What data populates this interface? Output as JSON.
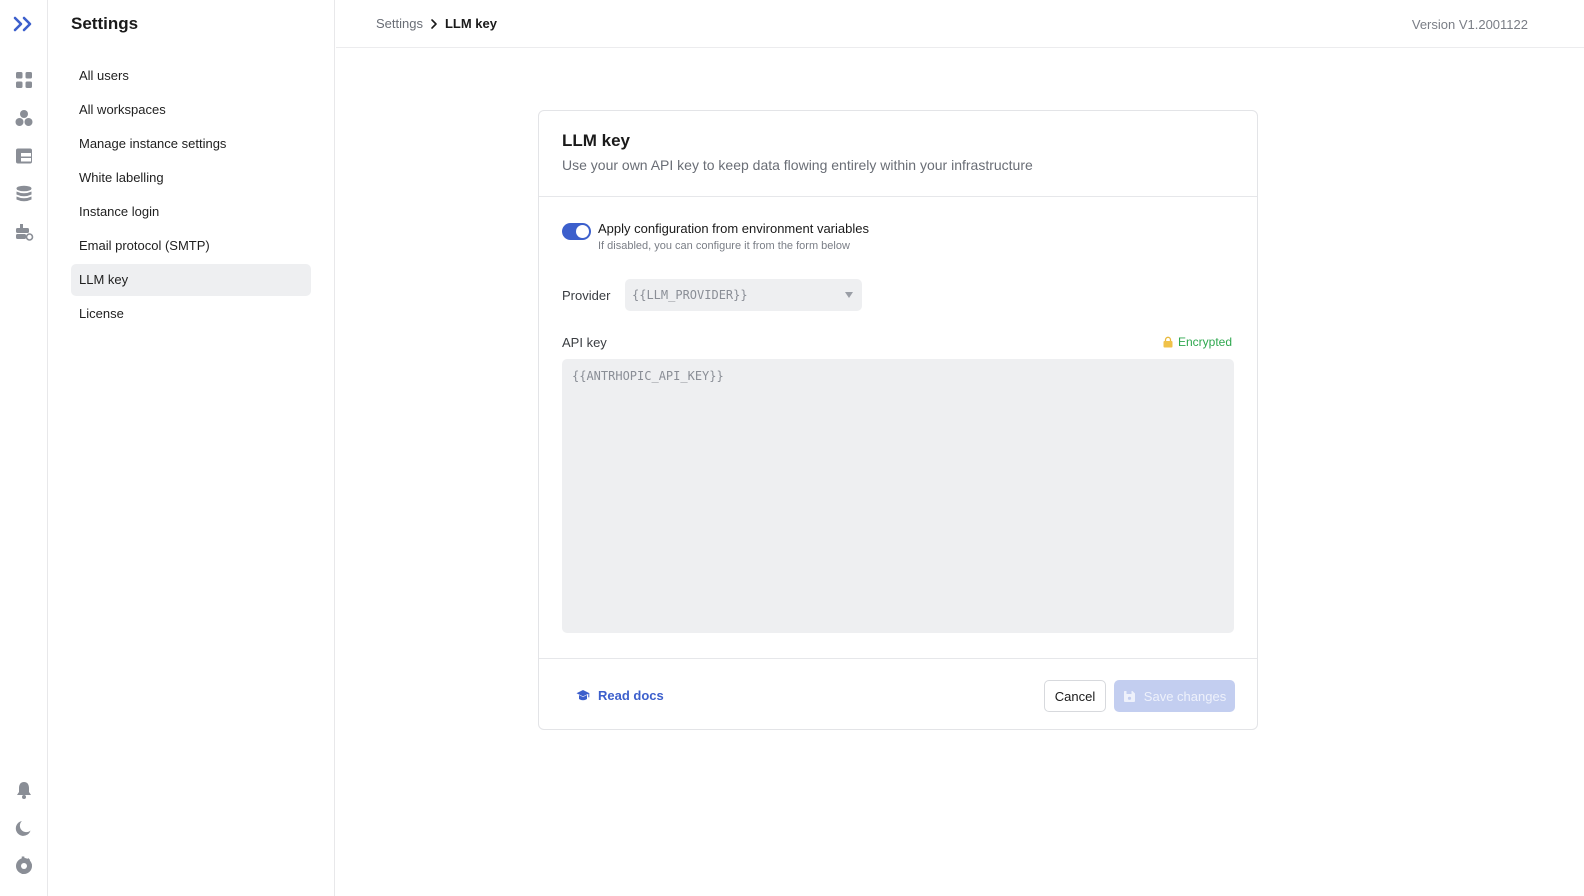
{
  "sidebar": {
    "title": "Settings",
    "items": [
      {
        "label": "All users"
      },
      {
        "label": "All workspaces"
      },
      {
        "label": "Manage instance settings"
      },
      {
        "label": "White labelling"
      },
      {
        "label": "Instance login"
      },
      {
        "label": "Email protocol (SMTP)"
      },
      {
        "label": "LLM key",
        "active": true
      },
      {
        "label": "License"
      }
    ]
  },
  "rail": {
    "icons": [
      "apps-grid-icon",
      "components-icon",
      "table-icon",
      "database-icon",
      "plugins-icon",
      "bell-icon",
      "moon-icon",
      "gear-icon"
    ]
  },
  "header": {
    "breadcrumb_parent": "Settings",
    "breadcrumb_current": "LLM key",
    "version": "Version V1.2001122"
  },
  "card": {
    "title": "LLM key",
    "subtitle": "Use your own API key to keep data flowing entirely within your infrastructure",
    "toggle_label": "Apply configuration from environment variables",
    "toggle_hint": "If disabled, you can configure it from the form below",
    "toggle_on": true,
    "provider_label": "Provider",
    "provider_value": "{{LLM_PROVIDER}}",
    "api_label": "API key",
    "encrypted_label": "Encrypted",
    "api_value": "{{ANTRHOPIC_API_KEY}}",
    "docs_label": "Read docs",
    "cancel_label": "Cancel",
    "save_label": "Save changes"
  },
  "colors": {
    "accent": "#3c5fcc",
    "encrypted": "#2fa84f",
    "save_disabled": "#c3cef0"
  }
}
